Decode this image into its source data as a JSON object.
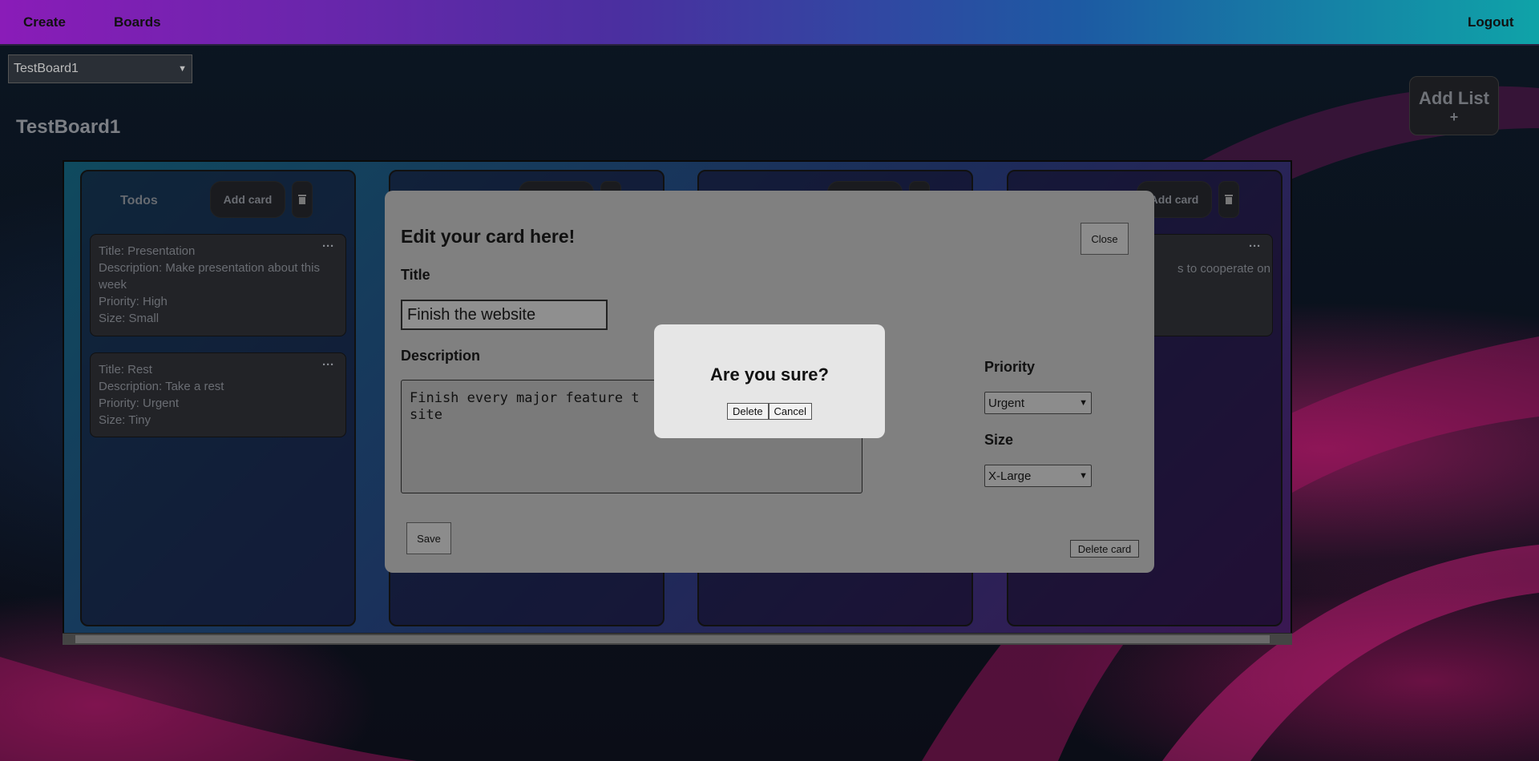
{
  "nav": {
    "create": "Create",
    "boards": "Boards",
    "logout": "Logout"
  },
  "board_select": {
    "value": "TestBoard1"
  },
  "board": {
    "title": "TestBoard1",
    "add_list": "Add List",
    "add_list_plus": "+"
  },
  "lists": [
    {
      "name": "Todos",
      "add_card": "Add card",
      "cards": [
        {
          "title": "Title: Presentation",
          "description": "Description: Make presentation about this week",
          "priority": "Priority: High",
          "size": "Size: Small"
        },
        {
          "title": "Title: Rest",
          "description": "Description: Take a rest",
          "priority": "Priority: Urgent",
          "size": "Size: Tiny"
        }
      ]
    },
    {
      "name": "",
      "add_card": ""
    },
    {
      "name": "",
      "add_card": ""
    },
    {
      "name": "",
      "add_card": "Add card",
      "cards": [
        {
          "snippet": "s to cooperate on"
        }
      ]
    }
  ],
  "edit_modal": {
    "heading": "Edit your card here!",
    "close": "Close",
    "title_label": "Title",
    "title_value": "Finish the website",
    "description_label": "Description",
    "description_value": "Finish every major feature t\nsite",
    "priority_label": "Priority",
    "priority_value": "Urgent",
    "size_label": "Size",
    "size_value": "X-Large",
    "save": "Save",
    "delete_card": "Delete card"
  },
  "confirm_dialog": {
    "heading": "Are you sure?",
    "delete": "Delete",
    "cancel": "Cancel"
  },
  "icons": {
    "more": "ellipsis-icon",
    "trash": "trash-icon",
    "dropdown": "chevron-down-icon"
  }
}
